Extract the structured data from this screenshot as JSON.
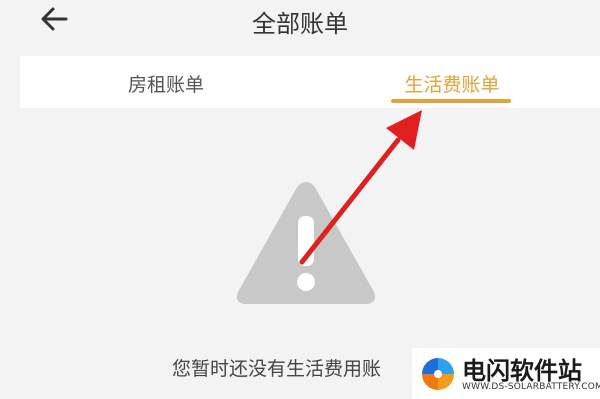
{
  "header": {
    "title": "全部账单",
    "back_icon": "back-arrow-icon"
  },
  "tabs": [
    {
      "label": "房租账单",
      "active": false
    },
    {
      "label": "生活费账单",
      "active": true
    }
  ],
  "colors": {
    "accent": "#e2a43a",
    "warning_icon": "#c8c8c8",
    "annotation_arrow": "#e02020",
    "background": "#f3f3f3"
  },
  "empty_state": {
    "icon": "warning-icon",
    "message": "您暂时还没有生活费用账"
  },
  "watermark": {
    "name": "电闪软件站",
    "url": "WWW.DS-SOLARBATTERY.COM"
  }
}
